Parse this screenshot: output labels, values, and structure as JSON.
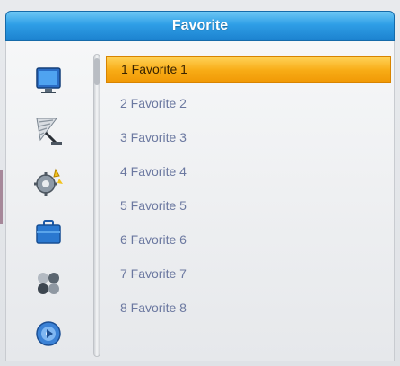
{
  "header": {
    "title": "Favorite"
  },
  "sidebar": {
    "items": [
      {
        "icon": "tv-monitor-icon"
      },
      {
        "icon": "satellite-dish-icon"
      },
      {
        "icon": "settings-gear-icon"
      },
      {
        "icon": "toolbox-icon"
      },
      {
        "icon": "game-balls-icon"
      },
      {
        "icon": "media-disc-icon"
      }
    ]
  },
  "list": {
    "selected_index": 0,
    "items": [
      {
        "label": "1 Favorite 1"
      },
      {
        "label": "2 Favorite 2"
      },
      {
        "label": "3 Favorite 3"
      },
      {
        "label": "4 Favorite 4"
      },
      {
        "label": "5 Favorite 5"
      },
      {
        "label": "6 Favorite 6"
      },
      {
        "label": "7 Favorite 7"
      },
      {
        "label": "8 Favorite 8"
      }
    ]
  },
  "colors": {
    "title_bar": "#2e9ee6",
    "highlight": "#f8ac16",
    "item_text": "#6b78a0"
  }
}
